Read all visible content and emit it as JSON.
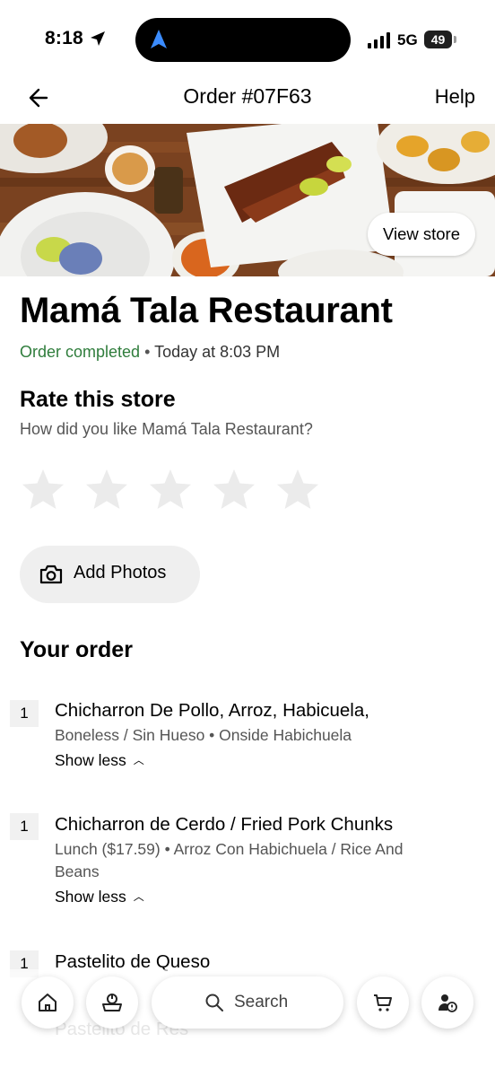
{
  "status_bar": {
    "time": "8:18",
    "network": "5G",
    "battery": "49"
  },
  "header": {
    "title": "Order #07F63",
    "help": "Help"
  },
  "hero": {
    "view_store": "View store"
  },
  "store": {
    "name": "Mamá Tala Restaurant",
    "status": "Order completed",
    "separator": "•",
    "time": "Today at 8:03 PM"
  },
  "rating": {
    "title": "Rate this store",
    "prompt": "How did you like Mamá Tala Restaurant?",
    "stars": 5
  },
  "add_photos": "Add Photos",
  "order": {
    "title": "Your order",
    "items": [
      {
        "qty": "1",
        "name": "Chicharron De Pollo, Arroz, Habicuela,",
        "desc": "Boneless / Sin Hueso • Onside Habichuela",
        "toggle": "Show less"
      },
      {
        "qty": "1",
        "name": "Chicharron de Cerdo / Fried Pork Chunks",
        "desc": "Lunch ($17.59) • Arroz Con Habichuela / Rice And Beans",
        "toggle": "Show less"
      },
      {
        "qty": "1",
        "name": "Pastelito de Queso"
      },
      {
        "name": "Pastelito de Res"
      }
    ]
  },
  "bottom_nav": {
    "search_label": "Search",
    "icons": [
      "home-icon",
      "grocery-icon",
      "search-icon",
      "cart-icon",
      "account-icon"
    ]
  }
}
